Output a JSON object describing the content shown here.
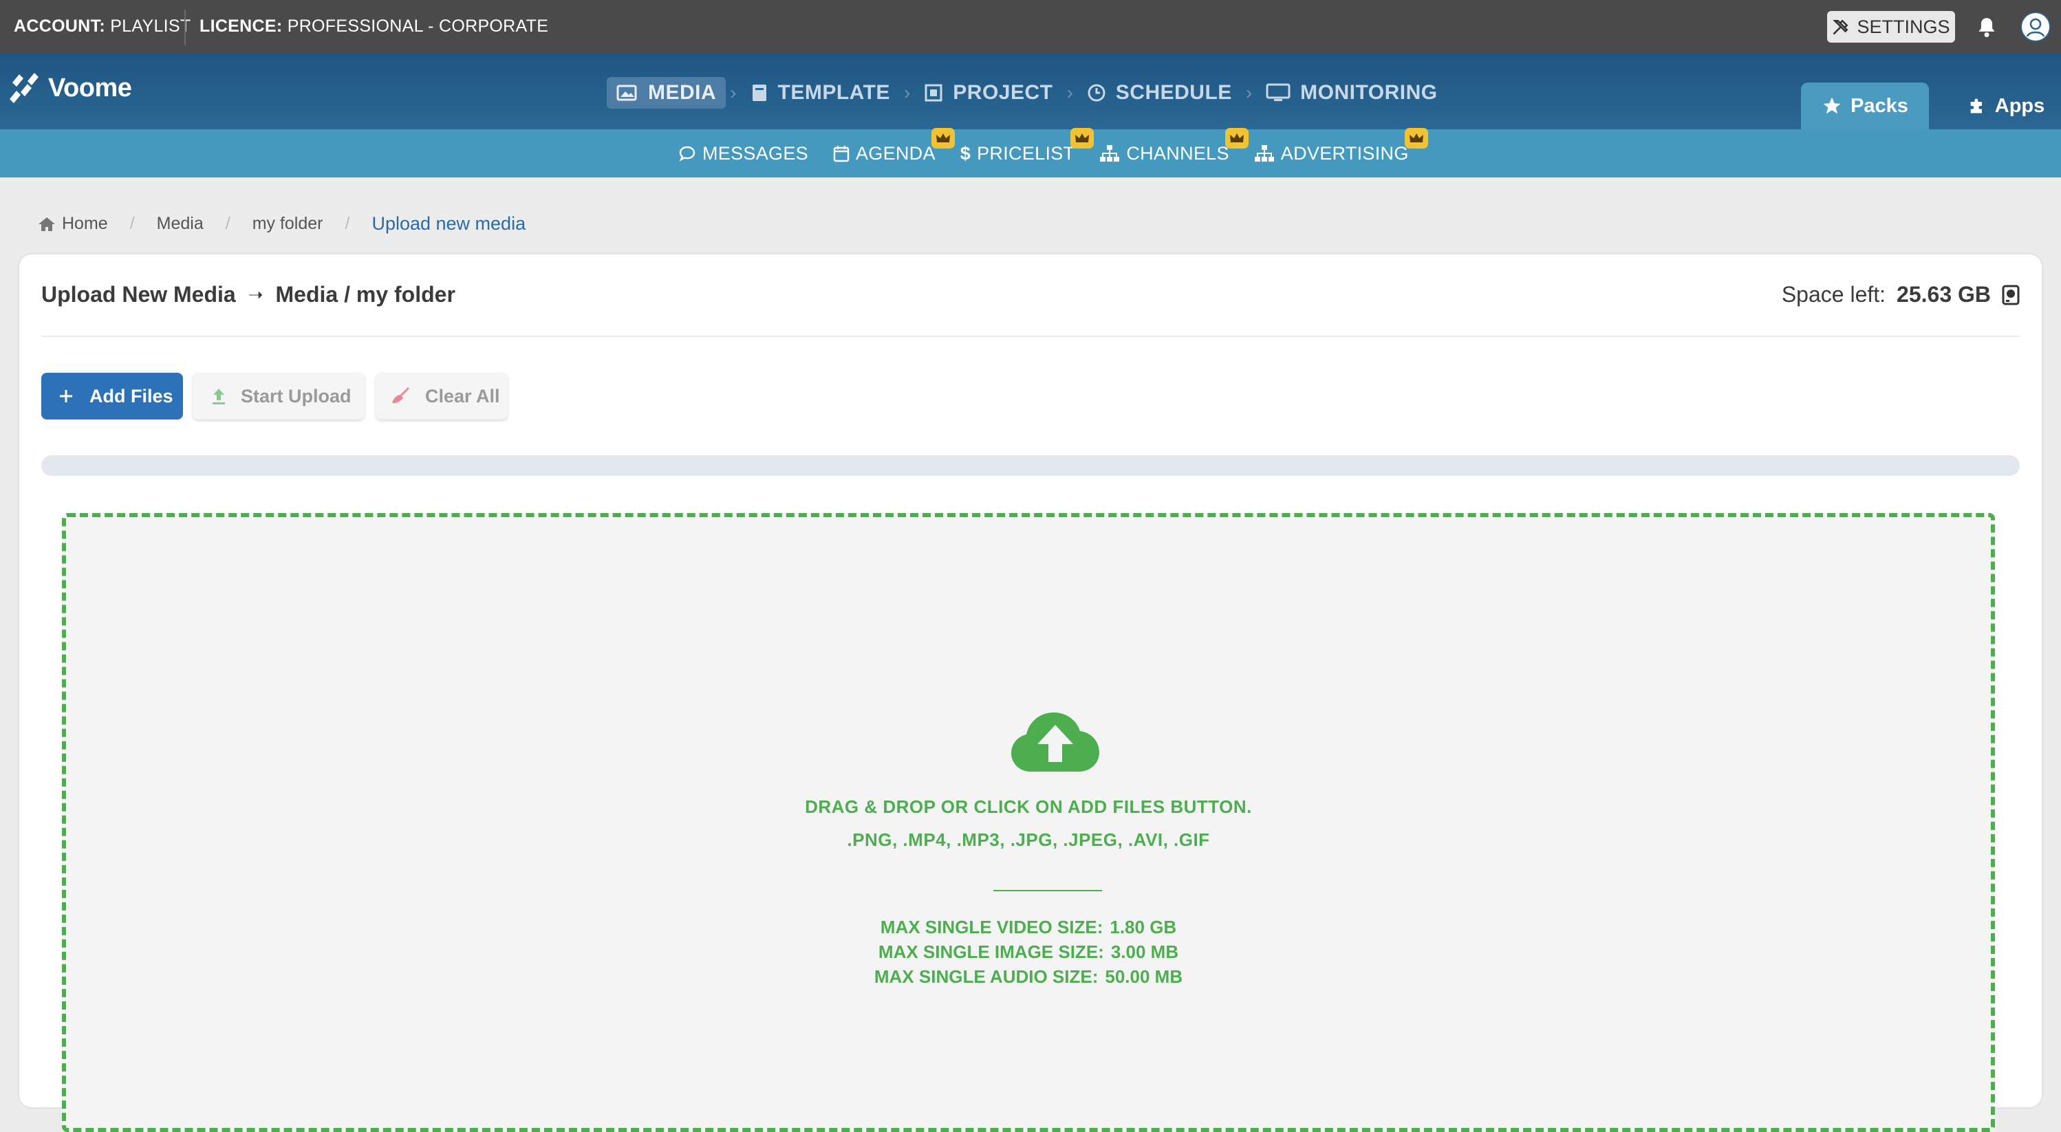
{
  "topbar": {
    "account_label": "ACCOUNT:",
    "account_value": "PLAYLIST",
    "licence_label": "LICENCE:",
    "licence_value": "PROFESSIONAL - CORPORATE",
    "settings_label": "SETTINGS"
  },
  "logo": {
    "text": "Voome"
  },
  "mainnav": {
    "items": [
      {
        "label": "MEDIA",
        "icon": "image-icon",
        "active": true
      },
      {
        "label": "TEMPLATE",
        "icon": "book-icon"
      },
      {
        "label": "PROJECT",
        "icon": "frame-icon"
      },
      {
        "label": "SCHEDULE",
        "icon": "clock-icon"
      },
      {
        "label": "MONITORING",
        "icon": "monitor-icon"
      }
    ],
    "packs_label": "Packs",
    "apps_label": "Apps"
  },
  "subnav": {
    "items": [
      {
        "label": "MESSAGES",
        "icon": "chat-icon",
        "premium": false
      },
      {
        "label": "AGENDA",
        "icon": "calendar-icon",
        "premium": true
      },
      {
        "label": "PRICELIST",
        "icon": "dollar-icon",
        "premium": true
      },
      {
        "label": "CHANNELS",
        "icon": "sitemap-icon",
        "premium": true
      },
      {
        "label": "ADVERTISING",
        "icon": "sitemap-icon",
        "premium": true
      }
    ]
  },
  "breadcrumb": {
    "items": [
      "Home",
      "Media",
      "my folder"
    ],
    "current": "Upload new media"
  },
  "card": {
    "title": "Upload New Media",
    "arrow": "➝",
    "destination": "Media / my folder",
    "space_label": "Space left:",
    "space_value": "25.63 GB"
  },
  "buttons": {
    "add": "Add Files",
    "start": "Start Upload",
    "clear": "Clear All"
  },
  "upload_progress": 0,
  "dropzone": {
    "instruction": "DRAG & DROP OR CLICK ON ADD FILES BUTTON.",
    "formats": ".PNG, .MP4, .MP3, .JPG, .JPEG, .AVI, .GIF",
    "limits": [
      {
        "label": "MAX SINGLE VIDEO SIZE:",
        "value": "1.80 GB"
      },
      {
        "label": "MAX SINGLE IMAGE SIZE:",
        "value": "3.00 MB"
      },
      {
        "label": "MAX SINGLE AUDIO SIZE:",
        "value": "50.00 MB"
      }
    ]
  },
  "colors": {
    "topbar": "#4a4a4a",
    "nav": "#2b6794",
    "subnav": "#4599bf",
    "primary": "#2d72b8",
    "dropzone": "#4cae4f",
    "crown": "#f1c232"
  }
}
